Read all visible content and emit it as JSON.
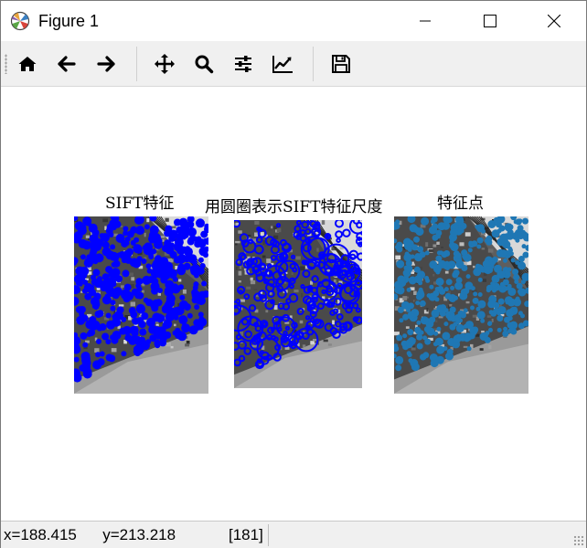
{
  "window": {
    "title": "Figure 1",
    "controls": [
      "minimize-icon",
      "maximize-icon",
      "close-icon"
    ]
  },
  "toolbar": {
    "buttons": [
      {
        "icon": "home-icon",
        "action": "home"
      },
      {
        "icon": "arrow-left-icon",
        "action": "back"
      },
      {
        "icon": "arrow-right-icon",
        "action": "forward"
      },
      {
        "icon": "move-icon",
        "action": "pan"
      },
      {
        "icon": "search-icon",
        "action": "zoom"
      },
      {
        "icon": "sliders-icon",
        "action": "configure subplots"
      },
      {
        "icon": "line-chart-icon",
        "action": "edit axis"
      },
      {
        "icon": "save-icon",
        "action": "save"
      }
    ]
  },
  "figure": {
    "subplots": [
      {
        "title": "SIFT特征",
        "marker_color": "#0000ff",
        "marker_style": "filled-dots"
      },
      {
        "title": "用圆圈表示SIFT特征尺度",
        "marker_color": "#0000ff",
        "marker_style": "circles"
      },
      {
        "title": "特征点",
        "marker_color": "#1f77b4",
        "marker_style": "filled-dots"
      }
    ]
  },
  "status": {
    "coords": "x=188.415      y=213.218",
    "value": "[181]"
  }
}
